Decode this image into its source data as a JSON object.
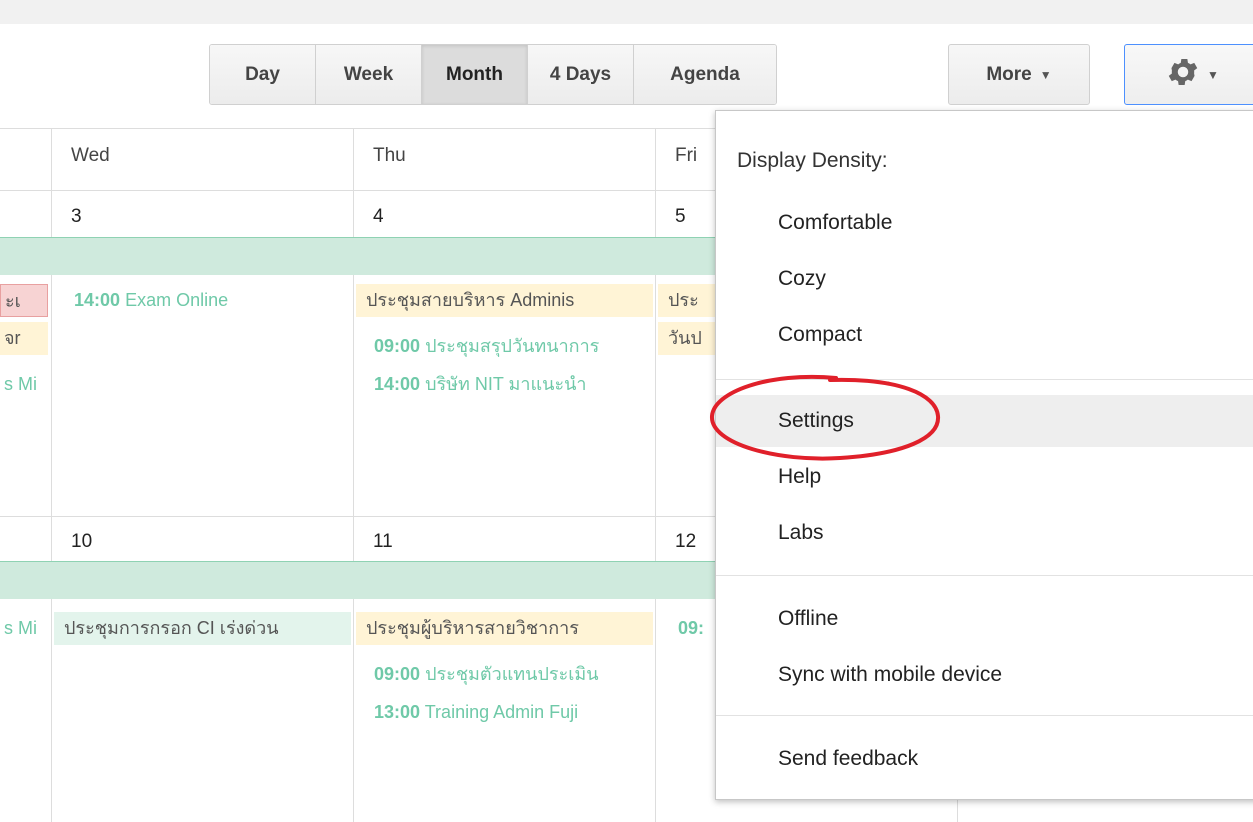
{
  "toolbar": {
    "views": [
      {
        "label": "Day",
        "active": false
      },
      {
        "label": "Week",
        "active": false
      },
      {
        "label": "Month",
        "active": true
      },
      {
        "label": "4 Days",
        "active": false
      },
      {
        "label": "Agenda",
        "active": false
      }
    ],
    "more_label": "More",
    "settings_icon": "gear-icon"
  },
  "calendar": {
    "day_headers": [
      "Wed",
      "Thu",
      "Fri"
    ],
    "week1": {
      "dates": [
        "3",
        "4",
        "5"
      ],
      "events": {
        "prev_col": [
          "ะเ",
          "จr",
          "s Mi"
        ],
        "wed": {
          "time": "14:00",
          "title": "Exam Online"
        },
        "thu_allday": "ประชุมสายบริหาร Adminis",
        "thu_1": {
          "time": "09:00",
          "title": "ประชุมสรุปวันทนาการ"
        },
        "thu_2": {
          "time": "14:00",
          "title": "บริษัท NIT มาแนะนำ"
        },
        "fri_1": "ประ",
        "fri_2": "วันป"
      }
    },
    "week2": {
      "dates": [
        "10",
        "11",
        "12"
      ],
      "events": {
        "prev_col": "s Mi",
        "wed_allday": "ประชุมการกรอก CI เร่งด่วน",
        "thu_allday": "ประชุมผู้บริหารสายวิชาการ",
        "thu_1": {
          "time": "09:00",
          "title": "ประชุมตัวแทนประเมิน"
        },
        "thu_2": {
          "time": "13:00",
          "title": "Training Admin Fuji"
        },
        "fri_1": "09:"
      }
    }
  },
  "settings_menu": {
    "density_title": "Display Density:",
    "density_options": [
      "Comfortable",
      "Cozy",
      "Compact"
    ],
    "group2": [
      "Settings",
      "Help",
      "Labs"
    ],
    "group3": [
      "Offline",
      "Sync with mobile device"
    ],
    "group4": [
      "Send feedback"
    ],
    "highlighted": "Settings",
    "annotation_color": "#e0202a"
  }
}
